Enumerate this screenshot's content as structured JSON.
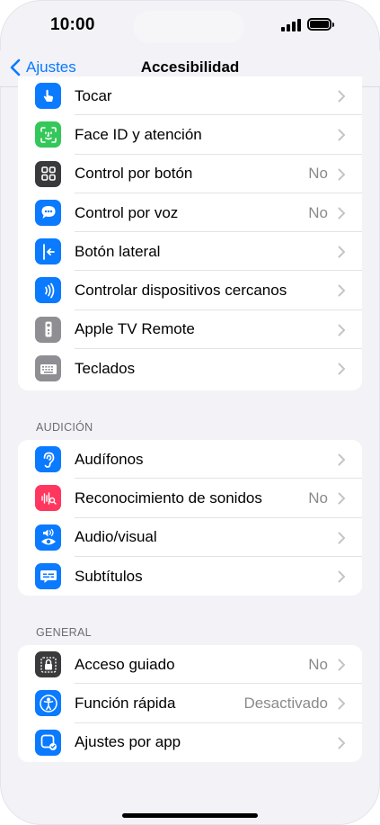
{
  "status": {
    "time": "10:00"
  },
  "nav": {
    "back_label": "Ajustes",
    "title": "Accesibilidad"
  },
  "group1": [
    {
      "label": "Tocar",
      "value": "",
      "icon": "hand-tap-icon",
      "color": "#0a7aff"
    },
    {
      "label": "Face ID y atención",
      "value": "",
      "icon": "face-id-icon",
      "color": "#34c759"
    },
    {
      "label": "Control por botón",
      "value": "No",
      "icon": "switch-control-icon",
      "color": "#3a3a3c"
    },
    {
      "label": "Control por voz",
      "value": "No",
      "icon": "voice-control-icon",
      "color": "#0a7aff"
    },
    {
      "label": "Botón lateral",
      "value": "",
      "icon": "side-button-icon",
      "color": "#0a7aff"
    },
    {
      "label": "Controlar dispositivos cercanos",
      "value": "",
      "icon": "nearby-devices-icon",
      "color": "#0a7aff"
    },
    {
      "label": "Apple TV Remote",
      "value": "",
      "icon": "tv-remote-icon",
      "color": "#8e8e93"
    },
    {
      "label": "Teclados",
      "value": "",
      "icon": "keyboard-icon",
      "color": "#8e8e93"
    }
  ],
  "section_hearing": "AUDICIÓN",
  "group2": [
    {
      "label": "Audífonos",
      "value": "",
      "icon": "ear-icon",
      "color": "#0a7aff"
    },
    {
      "label": "Reconocimiento de sonidos",
      "value": "No",
      "icon": "sound-recognition-icon",
      "color": "#ff375f"
    },
    {
      "label": "Audio/visual",
      "value": "",
      "icon": "audio-visual-icon",
      "color": "#0a7aff"
    },
    {
      "label": "Subtítulos",
      "value": "",
      "icon": "subtitles-icon",
      "color": "#0a7aff"
    }
  ],
  "section_general": "GENERAL",
  "group3": [
    {
      "label": "Acceso guiado",
      "value": "No",
      "icon": "guided-access-icon",
      "color": "#3a3a3c"
    },
    {
      "label": "Función rápida",
      "value": "Desactivado",
      "icon": "accessibility-shortcut-icon",
      "color": "#0a7aff"
    },
    {
      "label": "Ajustes por app",
      "value": "",
      "icon": "per-app-settings-icon",
      "color": "#0a7aff"
    }
  ]
}
